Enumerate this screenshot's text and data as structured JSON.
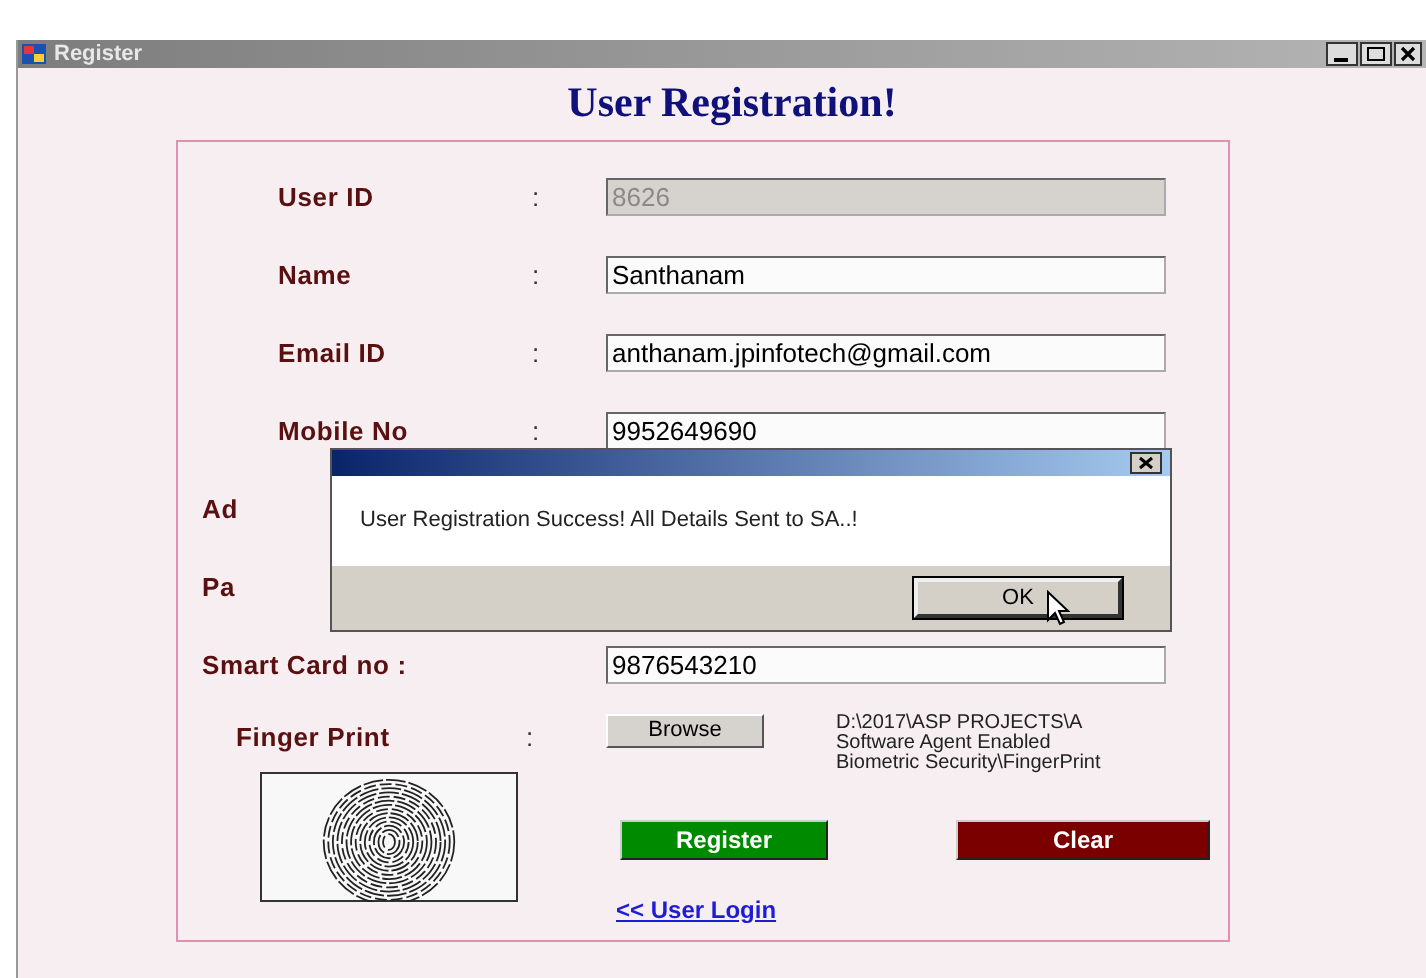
{
  "window": {
    "title": "Register"
  },
  "form": {
    "heading": "User Registration!",
    "fields": [
      {
        "label": "User ID",
        "separator": ":",
        "value": "8626",
        "disabled": true
      },
      {
        "label": "Name",
        "separator": ":",
        "value": "Santhanam",
        "disabled": false
      },
      {
        "label": "Email ID",
        "separator": ":",
        "value": "anthanam.jpinfotech@gmail.com",
        "disabled": false
      },
      {
        "label": "Mobile No",
        "separator": ":",
        "value": "9952649690",
        "disabled": false
      },
      {
        "label": "Ad"
      },
      {
        "label": "Pa"
      },
      {
        "label": "Smart Card no :",
        "value": "9876543210",
        "disabled": false
      }
    ],
    "file": {
      "label": "Finger Print",
      "separator": ":",
      "button": "Browse",
      "path_lines": [
        "D:\\2017\\ASP PROJECTS\\A",
        "Software Agent Enabled",
        "Biometric Security\\FingerPrint"
      ]
    },
    "actions": [
      {
        "label": "Register",
        "kind": "primary"
      },
      {
        "label": "Clear",
        "kind": "danger"
      }
    ],
    "link": "<< User Login"
  },
  "dialog": {
    "message": "User Registration Success! All Details Sent to SA..!",
    "button": "OK"
  }
}
